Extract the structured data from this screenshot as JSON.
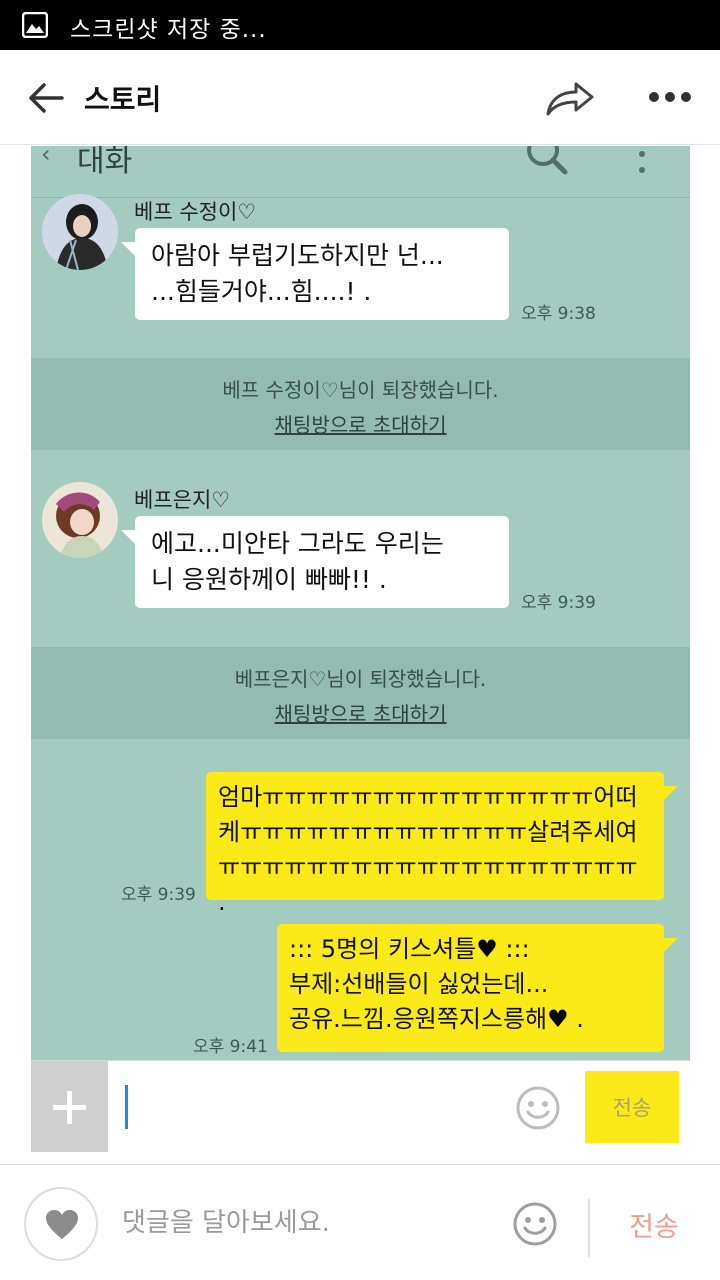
{
  "status_bar": {
    "text": "스크린샷 저장 중..."
  },
  "header": {
    "title": "스토리"
  },
  "story": {
    "inner_header": {
      "title": "대화"
    },
    "messages": [
      {
        "sender": "베프 수정이♡",
        "lines": "아람아 부럽기도하지만 넌...\n...힘들거야...힘....! .",
        "time": "오후 9:38"
      },
      {
        "sender": "베프은지♡",
        "lines": "에고...미안타 그라도 우리는\n니 응원하께이 빠빠!! .",
        "time": "오후 9:39"
      }
    ],
    "notices": [
      {
        "text": "베프 수정이♡님이 퇴장했습니다.",
        "link": "채팅방으로 초대하기"
      },
      {
        "text": "베프은지♡님이 퇴장했습니다.",
        "link": "채팅방으로 초대하기"
      }
    ],
    "my_messages": [
      {
        "lines": "엄마ㅠㅠㅠㅠㅠㅠㅠㅠㅠㅠㅠㅠㅠㅠㅠ어떠\n케ㅠㅠㅠㅠㅠㅠㅠㅠㅠㅠㅠㅠㅠ살려주세여\nㅠㅠㅠㅠㅠㅠㅠㅠㅠㅠㅠㅠㅠㅠㅠㅠㅠㅠㅠ .",
        "time": "오후 9:39"
      },
      {
        "line1_pre": "::: 5명의 키스셔틀",
        "line1_post": " :::",
        "line2": "부제:선배들이 싫었는데...",
        "line3_pre": "공유.느낌.응원쪽지스릉해",
        "line3_post": " .",
        "heart": "♥",
        "time": "오후 9:41"
      }
    ],
    "input": {
      "send_label": "전송"
    }
  },
  "comment_bar": {
    "placeholder": "댓글을 달아보세요.",
    "send_label": "전송"
  },
  "colors": {
    "chat_bg": "#a3cbbf",
    "notice_bg": "#93bcb0",
    "my_bubble": "#fbea18",
    "send_text": "#f29d8f"
  },
  "icons": [
    "screenshot-icon",
    "back-arrow-icon",
    "share-icon",
    "more-icon",
    "search-icon",
    "smiley-icon",
    "heart-icon",
    "plus-icon"
  ]
}
